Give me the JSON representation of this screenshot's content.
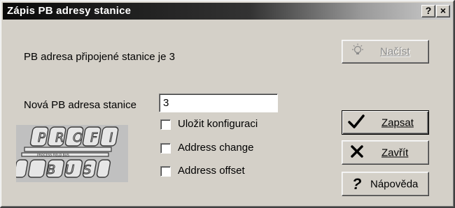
{
  "window": {
    "title": "Zápis PB adresy stanice",
    "help_glyph": "?",
    "close_glyph": "×"
  },
  "main": {
    "connected_label": "PB adresa připojené stanice je 3",
    "new_address_label": "Nová PB adresa stanice",
    "new_address_value": "3"
  },
  "options": [
    {
      "label": "Uložit konfiguraci",
      "checked": false
    },
    {
      "label": "Address change",
      "checked": false
    },
    {
      "label": "Address offset",
      "checked": false
    }
  ],
  "buttons": {
    "load": {
      "label": "Načíst",
      "icon": "lightbulb-icon",
      "enabled": false
    },
    "write": {
      "label": "Zapsat",
      "icon": "checkmark-icon"
    },
    "close": {
      "label": "Zavřít",
      "icon": "x-icon"
    },
    "help": {
      "label": "Nápověda",
      "icon": "question-icon"
    }
  },
  "logo": {
    "top_letters": [
      "P",
      "R",
      "O",
      "F",
      "I"
    ],
    "bottom_letters": [
      "B",
      "U",
      "S"
    ],
    "bar_text": "PROCESS FIELD BUS"
  }
}
